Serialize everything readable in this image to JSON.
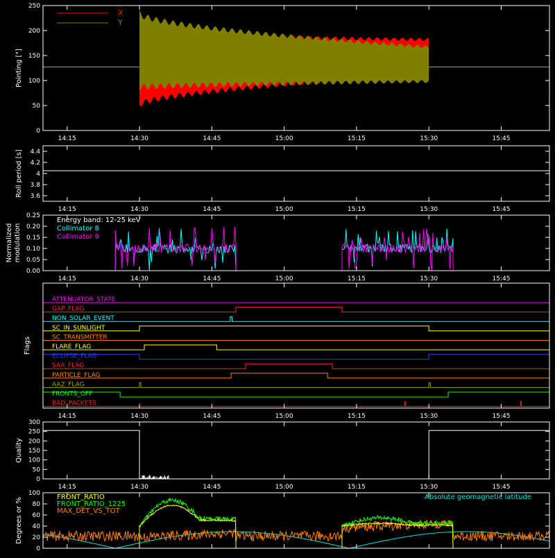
{
  "colors": {
    "background": "#000000",
    "axes": "#ffffff",
    "x_pointing": "#ff0000",
    "y_pointing": "#808000",
    "collimator_8": "#00ffff",
    "collimator_9": "#ff00ff",
    "front_ratio": "#ffff00",
    "front_ratio_1225": "#00ff00",
    "max_det_vs_tot": "#ff8000",
    "geomag_lat": "#00e0e0"
  },
  "time_axis": {
    "range": [
      "14:10",
      "15:55"
    ],
    "ticks": [
      "14:15",
      "14:30",
      "14:45",
      "15:00",
      "15:15",
      "15:30",
      "15:45"
    ]
  },
  "chart_data": [
    {
      "type": "line",
      "name": "pointing",
      "ylabel": "Pointing [\"]",
      "ylim": [
        0,
        250
      ],
      "yticks": [
        0,
        50,
        100,
        150,
        200,
        250
      ],
      "legend_position": "top-left",
      "series": [
        {
          "name": "X",
          "color": "#ff0000",
          "center_before": 127,
          "start": "14:30",
          "end": "15:30",
          "envelope_start": [
            45,
            200
          ],
          "envelope_end": [
            110,
            185
          ]
        },
        {
          "name": "Y",
          "color": "#808000",
          "center_before": 127,
          "start": "14:30",
          "end": "15:30",
          "envelope_start": [
            80,
            240
          ],
          "envelope_end": [
            95,
            170
          ]
        }
      ]
    },
    {
      "type": "line",
      "name": "roll-period",
      "ylabel": "Roll period [s]",
      "ylim": [
        3.5,
        4.5
      ],
      "yticks": [
        3.6,
        3.8,
        4.0,
        4.2,
        4.4
      ],
      "series": [
        {
          "name": "",
          "value": 4.05
        }
      ]
    },
    {
      "type": "line",
      "name": "modulation",
      "ylabel_lines": [
        "Normalized",
        "modulation"
      ],
      "ylim": [
        0,
        0.25
      ],
      "yticks": [
        "0.00",
        "0.05",
        "0.10",
        "0.15",
        "0.20",
        "0.25"
      ],
      "annotation": "Energy band: 12-25 keV",
      "series": [
        {
          "name": "Collimator 8",
          "color": "#00ffff",
          "intervals": [
            [
              "14:25",
              "14:50"
            ],
            [
              "15:12",
              "15:35"
            ]
          ],
          "level": 0.1
        },
        {
          "name": "Collimator 9",
          "color": "#ff00ff",
          "intervals": [
            [
              "14:25",
              "14:50"
            ],
            [
              "15:12",
              "15:35"
            ]
          ],
          "level": 0.1
        }
      ]
    },
    {
      "type": "line",
      "name": "flags",
      "ylabel": "Flags",
      "series": [
        {
          "name": "ATTENUATOR_STATE",
          "color": "#ff00ff",
          "highs": []
        },
        {
          "name": "GAP_FLAG",
          "color": "#ff2020",
          "highs": [
            [
              "14:50",
              "15:12"
            ]
          ]
        },
        {
          "name": "NON_SOLAR_EVENT",
          "color": "#00ffff",
          "highs": [
            [
              "14:48.8",
              "14:49.2"
            ]
          ]
        },
        {
          "name": "SC_IN_SUNLIGHT",
          "color": "#ffff00",
          "highs": [
            [
              "14:30",
              "15:30"
            ]
          ]
        },
        {
          "name": "SC_TRANSMITTER",
          "color": "#ff8000",
          "highs": []
        },
        {
          "name": "FLARE_FLAG",
          "color": "#ffff00",
          "highs": [
            [
              "14:31",
              "14:46"
            ]
          ]
        },
        {
          "name": "ECLIPSE_FLAG",
          "color": "#2040ff",
          "highs": [
            [
              "14:10",
              "14:30"
            ],
            [
              "15:30",
              "15:55"
            ]
          ]
        },
        {
          "name": "SAA_FLAG",
          "color": "#ff2020",
          "highs": [
            [
              "14:52",
              "15:10"
            ]
          ]
        },
        {
          "name": "PARTICLE_FLAG",
          "color": "#ff8000",
          "highs": [
            [
              "14:49",
              "15:09"
            ]
          ]
        },
        {
          "name": "AAZ_FLAG",
          "color": "#a0a000",
          "highs": [
            [
              "14:30",
              "14:30.3"
            ],
            [
              "15:30",
              "15:30.3"
            ]
          ]
        },
        {
          "name": "FRONTS_OFF",
          "color": "#00ff00",
          "highs": [
            [
              "14:10",
              "14:26"
            ],
            [
              "15:34",
              "15:55"
            ]
          ]
        },
        {
          "name": "BAD_PACKETS",
          "color": "#ff2020",
          "highs": [
            [
              "15:25",
              "15:25.2"
            ],
            [
              "15:49",
              "15:49.2"
            ]
          ]
        }
      ]
    },
    {
      "type": "line",
      "name": "quality",
      "ylabel": "Quality",
      "ylim": [
        0,
        300
      ],
      "yticks": [
        0,
        50,
        100,
        150,
        200,
        250,
        300
      ],
      "series": [
        {
          "name": "",
          "segments": [
            [
              "14:10",
              255
            ],
            [
              "14:30",
              0
            ],
            [
              "15:30",
              255
            ]
          ]
        }
      ]
    },
    {
      "type": "line",
      "name": "ratios",
      "ylabel": "Degrees or %",
      "ylim": [
        0,
        100
      ],
      "yticks": [
        0,
        20,
        40,
        60,
        80,
        100
      ],
      "annotation": "Absolute geomagnetic latitude",
      "series": [
        {
          "name": "FRONT_RATIO",
          "color": "#ffff00"
        },
        {
          "name": "FRONT_RATIO_1225",
          "color": "#00ff00"
        },
        {
          "name": "MAX_DET_VS_TOT",
          "color": "#ff8000"
        }
      ]
    }
  ]
}
